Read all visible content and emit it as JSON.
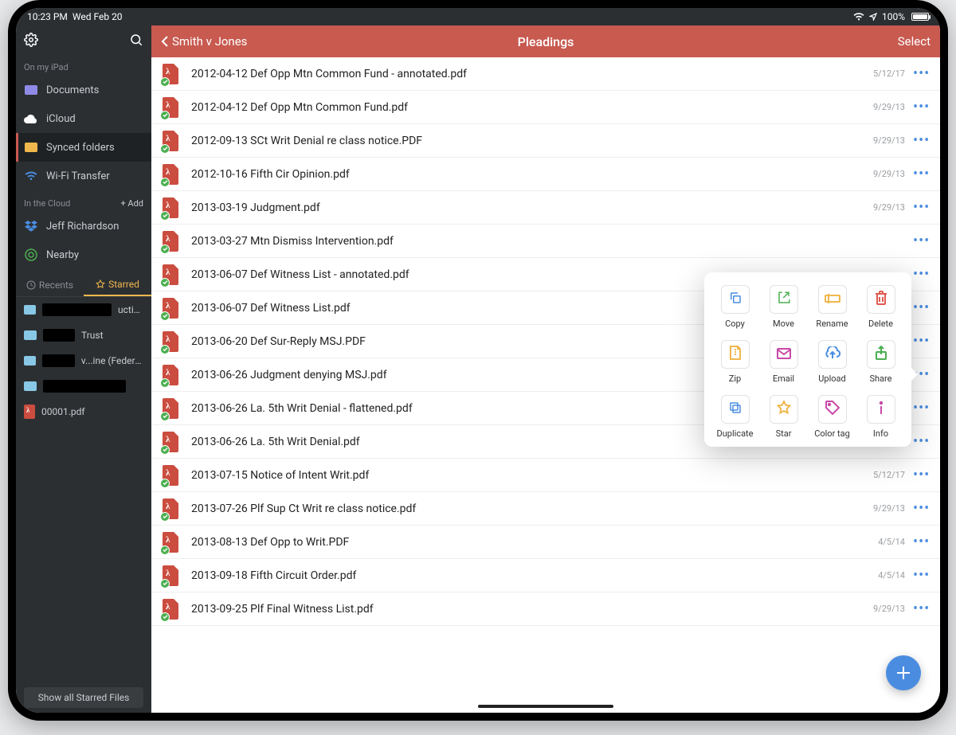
{
  "statusbar": {
    "time": "10:23 PM",
    "date": "Wed Feb 20",
    "battery": "100%"
  },
  "sidebar": {
    "section1_title": "On my iPad",
    "documents": "Documents",
    "icloud": "iCloud",
    "synced": "Synced folders",
    "wifi": "Wi-Fi Transfer",
    "section2_title": "In the Cloud",
    "add": "+ Add",
    "dropbox": "Jeff Richardson",
    "nearby": "Nearby",
    "tab_recents": "Recents",
    "tab_starred": "Starred",
    "starred": [
      {
        "suffix": "uction",
        "redact_w": 90,
        "folder": "#88c8e6"
      },
      {
        "suffix": "Trust",
        "redact_w": 40,
        "folder": "#88c8e6"
      },
      {
        "suffix": "v...ine (Federal)",
        "redact_w": 42,
        "folder": "#88c8e6"
      },
      {
        "suffix": "",
        "redact_w": 104,
        "folder": "#88c8e6"
      },
      {
        "suffix": "00001.pdf",
        "redact_w": 0,
        "pdf": true
      }
    ],
    "show_all": "Show all Starred Files"
  },
  "navbar": {
    "back": "Smith v Jones",
    "title": "Pleadings",
    "select": "Select"
  },
  "files": [
    {
      "name": "2012-04-12 Def Opp Mtn Common Fund - annotated.pdf",
      "date": "5/12/17"
    },
    {
      "name": "2012-04-12 Def Opp Mtn Common Fund.pdf",
      "date": "9/29/13"
    },
    {
      "name": "2012-09-13 SCt Writ Denial re class notice.PDF",
      "date": "9/29/13"
    },
    {
      "name": "2012-10-16 Fifth Cir Opinion.pdf",
      "date": "9/29/13"
    },
    {
      "name": "2013-03-19 Judgment.pdf",
      "date": "9/29/13"
    },
    {
      "name": "2013-03-27 Mtn Dismiss Intervention.pdf",
      "date": ""
    },
    {
      "name": "2013-06-07 Def Witness List - annotated.pdf",
      "date": ""
    },
    {
      "name": "2013-06-07 Def Witness List.pdf",
      "date": ""
    },
    {
      "name": "2013-06-20 Def Sur-Reply MSJ.PDF",
      "date": ""
    },
    {
      "name": "2013-06-26 Judgment denying MSJ.pdf",
      "date": ""
    },
    {
      "name": "2013-06-26 La. 5th Writ Denial - flattened.pdf",
      "date": ""
    },
    {
      "name": "2013-06-26 La. 5th Writ Denial.pdf",
      "date": ""
    },
    {
      "name": "2013-07-15 Notice of Intent Writ.pdf",
      "date": "5/12/17"
    },
    {
      "name": "2013-07-26 Plf Sup Ct Writ re class notice.pdf",
      "date": "9/29/13"
    },
    {
      "name": "2013-08-13 Def Opp to Writ.PDF",
      "date": "4/5/14"
    },
    {
      "name": "2013-09-18 Fifth Circuit Order.pdf",
      "date": "4/5/14"
    },
    {
      "name": "2013-09-25 Plf Final Witness List.pdf",
      "date": "9/29/13"
    }
  ],
  "actions": [
    {
      "key": "copy",
      "label": "Copy",
      "color": "#4a8de0"
    },
    {
      "key": "move",
      "label": "Move",
      "color": "#4caf50"
    },
    {
      "key": "rename",
      "label": "Rename",
      "color": "#f0b74d"
    },
    {
      "key": "delete",
      "label": "Delete",
      "color": "#e05a50"
    },
    {
      "key": "zip",
      "label": "Zip",
      "color": "#f0b74d"
    },
    {
      "key": "email",
      "label": "Email",
      "color": "#c94aa8"
    },
    {
      "key": "upload",
      "label": "Upload",
      "color": "#4a8de0"
    },
    {
      "key": "share",
      "label": "Share",
      "color": "#4caf50"
    },
    {
      "key": "duplicate",
      "label": "Duplicate",
      "color": "#4a8de0"
    },
    {
      "key": "star",
      "label": "Star",
      "color": "#f0b74d"
    },
    {
      "key": "colortag",
      "label": "Color tag",
      "color": "#c94aa8"
    },
    {
      "key": "info",
      "label": "Info",
      "color": "#c94aa8"
    }
  ]
}
